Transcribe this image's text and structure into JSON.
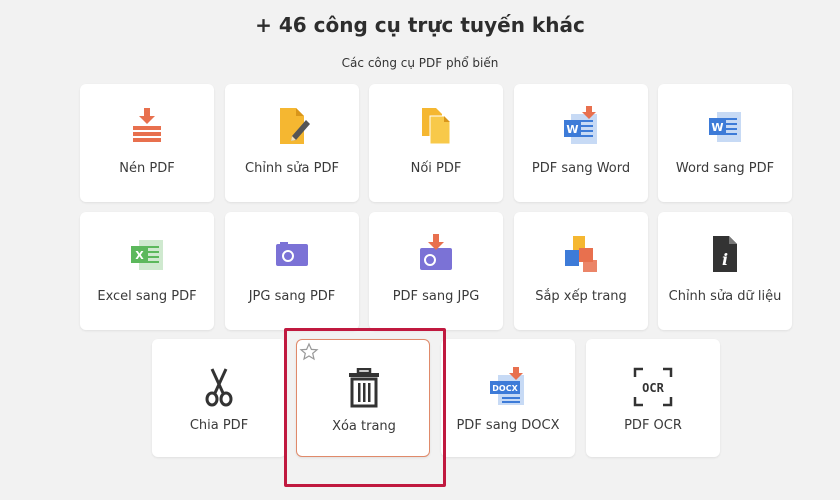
{
  "header": {
    "title": "+ 46 công cụ trực tuyến khác",
    "subtitle": "Các công cụ PDF phổ biến"
  },
  "tools": [
    {
      "label": "Nén PDF",
      "icon": "compress-icon"
    },
    {
      "label": "Chỉnh sửa PDF",
      "icon": "edit-pdf-icon"
    },
    {
      "label": "Nối PDF",
      "icon": "merge-icon"
    },
    {
      "label": "PDF sang Word",
      "icon": "pdf-to-word-icon"
    },
    {
      "label": "Word sang PDF",
      "icon": "word-to-pdf-icon"
    },
    {
      "label": "Excel sang PDF",
      "icon": "excel-to-pdf-icon"
    },
    {
      "label": "JPG sang PDF",
      "icon": "jpg-to-pdf-icon"
    },
    {
      "label": "PDF sang JPG",
      "icon": "pdf-to-jpg-icon"
    },
    {
      "label": "Sắp xếp trang",
      "icon": "organize-pages-icon"
    },
    {
      "label": "Chỉnh sửa dữ liệu",
      "icon": "edit-metadata-icon"
    },
    {
      "label": "Chia PDF",
      "icon": "scissors-icon"
    },
    {
      "label": "Xóa trang",
      "icon": "trash-icon"
    },
    {
      "label": "PDF sang DOCX",
      "icon": "pdf-to-docx-icon"
    },
    {
      "label": "PDF OCR",
      "icon": "ocr-icon"
    }
  ],
  "icon_text": {
    "word_letter": "W",
    "excel_letter": "X",
    "info_letter": "i",
    "docx_text": "DOCX",
    "ocr_text": "OCR"
  },
  "colors": {
    "accent_orange": "#e8704e",
    "word_blue": "#3d7bd8",
    "excel_green": "#5cb85c",
    "purple": "#7b72d6",
    "highlight_red": "#c0193f"
  }
}
